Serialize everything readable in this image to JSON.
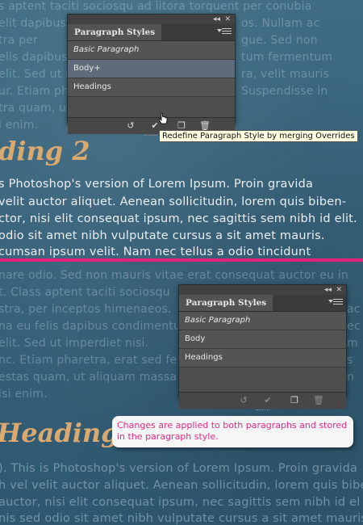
{
  "top_text": [
    "s aptent taciti sociosqu ad litora torquent per conubia",
    "elit dapibus",
    "tra per",
    "elis dapibus",
    "elit. Sed ut i",
    "ur. Etiam pharetra",
    "tra quam, ut aliqu",
    "i enim."
  ],
  "top_right_text": [
    "os. Nullam ac",
    "gue. Sed non",
    "tum fermentum",
    "ra, velit mauris",
    "Suspendisse in"
  ],
  "heading_1": "ding 2",
  "para_1": [
    "s Photoshop's version  of Lorem Ipsum. Proin gravida",
    "velit auctor aliquet. Aenean sollicitudin, lorem quis biben-",
    "ctor, nisi elit consequat ipsum, nec sagittis sem nibh id elit.",
    "odio sit amet nibh vulputate cursus a sit amet mauris.",
    "cumsan ipsum velit. Nam nec tellus a odio tincidunt"
  ],
  "mid_text": [
    "nare odio. Sed non  mauris vitae erat consequat auctor eu in",
    "t. Class aptent taciti sociosqu",
    "stra, per inceptos himenaeos.",
    "na eu felis dapibus condimentu",
    "elit. Sed ut imperdiet nisi.",
    "nc. Etiam pharetra, erat sed fe",
    "estas quam, ut aliquam massa",
    "isi enim."
  ],
  "mid_right_text": [
    "ac",
    "ec",
    "m",
    "s",
    "n"
  ],
  "heading_2": "Heading 2",
  "para_2": [
    "). This is Photoshop's version  of Lorem Ipsum. Proin gravida",
    "h vel velit auctor aliquet. Aenean sollicitudin, lorem quis biber",
    "auctor, nisi elit consequat ipsum, nec sagittis sem nibh id el",
    "nis sed odio sit amet nibh vulputate cursus a sit amet mauris."
  ],
  "panel_top": {
    "title": "Paragraph Styles",
    "items": [
      {
        "label": "Basic Paragraph",
        "italic": true,
        "selected": false
      },
      {
        "label": "Body+",
        "italic": false,
        "selected": true
      },
      {
        "label": "Headings",
        "italic": false,
        "selected": false
      }
    ]
  },
  "panel_bottom": {
    "title": "Paragraph Styles",
    "items": [
      {
        "label": "Basic Paragraph",
        "italic": true,
        "selected": false
      },
      {
        "label": "Body",
        "italic": false,
        "selected": false
      },
      {
        "label": "Headings",
        "italic": false,
        "selected": false
      }
    ]
  },
  "panel_controls": {
    "collapse": "◂◂",
    "close": "✕"
  },
  "tooltip": "Redefine Paragraph Style by merging Overrides",
  "callout": "Changes are applied to both paragraphs and stored in the paragraph style.",
  "colors": {
    "accent": "#e6217d",
    "heading": "#d9a96f",
    "panel": "#535353"
  }
}
